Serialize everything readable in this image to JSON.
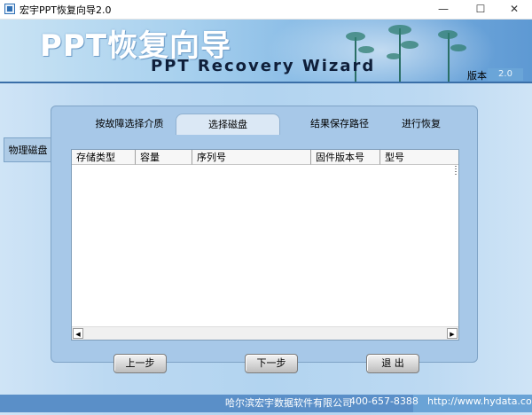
{
  "window": {
    "title": "宏宇PPT恢复向导2.0",
    "minimize": "—",
    "maximize": "☐",
    "close": "✕"
  },
  "banner": {
    "title_cn": "PPT恢复向导",
    "title_en": "PPT Recovery Wizard",
    "version_label": "版本",
    "version_value": "2.0"
  },
  "sidebar": {
    "items": [
      {
        "label": "物理磁盘"
      }
    ]
  },
  "tabs": [
    {
      "label": "按故障选择介质",
      "active": false
    },
    {
      "label": "选择磁盘",
      "active": true
    },
    {
      "label": "结果保存路径",
      "active": false
    },
    {
      "label": "进行恢复",
      "active": false
    }
  ],
  "table": {
    "columns": [
      "存储类型",
      "容量",
      "序列号",
      "固件版本号",
      "型号"
    ],
    "rows": []
  },
  "buttons": {
    "prev": "上一步",
    "next": "下一步",
    "exit": "退 出"
  },
  "footer": {
    "company": "哈尔滨宏宇数据软件有限公司",
    "phone": "400-657-8388",
    "url": "http://www.hydata.com"
  },
  "colors": {
    "accent": "#5a8fc8",
    "panel": "#a7c8e8"
  }
}
